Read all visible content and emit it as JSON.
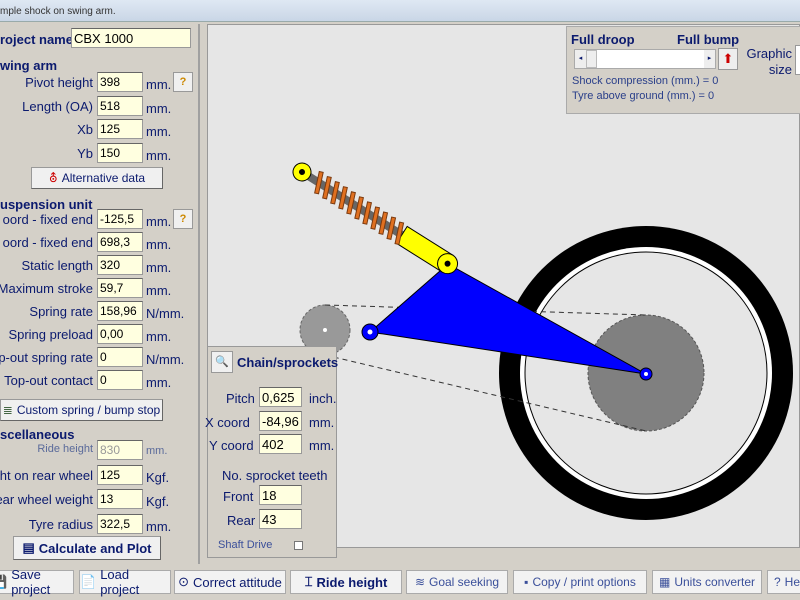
{
  "window": {
    "title": "mple shock on swing arm."
  },
  "project": {
    "label": "roject name",
    "value": "CBX 1000"
  },
  "swing_arm": {
    "header": "wing arm",
    "fields": [
      {
        "label": "Pivot height",
        "value": "398",
        "unit": "mm."
      },
      {
        "label": "Length (OA)",
        "value": "518",
        "unit": "mm."
      },
      {
        "label": "Xb",
        "value": "125",
        "unit": "mm."
      },
      {
        "label": "Yb",
        "value": "150",
        "unit": "mm."
      }
    ],
    "alt_button": "Alternative data",
    "help": "?"
  },
  "suspension": {
    "header": "uspension unit",
    "fields": [
      {
        "label": "oord - fixed end",
        "value": "-125,5",
        "unit": "mm."
      },
      {
        "label": "oord - fixed end",
        "value": "698,3",
        "unit": "mm."
      },
      {
        "label": "Static length",
        "value": "320",
        "unit": "mm."
      },
      {
        "label": "Maximum stroke",
        "value": "59,7",
        "unit": "mm."
      },
      {
        "label": "Spring rate",
        "value": "158,96",
        "unit": "N/mm."
      },
      {
        "label": "Spring preload",
        "value": "0,00",
        "unit": "mm."
      },
      {
        "label": "p-out spring rate",
        "value": "0",
        "unit": "N/mm."
      },
      {
        "label": "Top-out contact",
        "value": "0",
        "unit": "mm."
      }
    ],
    "custom_button": "Custom spring / bump stop",
    "help": "?"
  },
  "misc": {
    "header": "scellaneous",
    "fields": [
      {
        "label": "Ride height",
        "value": "830",
        "unit": "mm.",
        "disabled": true
      },
      {
        "label": "ght on rear wheel",
        "value": "125",
        "unit": "Kgf."
      },
      {
        "label": "ear wheel weight",
        "value": "13",
        "unit": "Kgf."
      },
      {
        "label": "Tyre radius",
        "value": "322,5",
        "unit": "mm."
      }
    ],
    "calc_button": "Calculate and Plot"
  },
  "control": {
    "full_droop": "Full droop",
    "full_bump": "Full bump",
    "graphic_size": "Graphic size",
    "slider_value": 0,
    "shock_compression": "Shock compression (mm.) = 0",
    "tyre_above": "Tyre  above ground (mm.) =   0"
  },
  "chain": {
    "title": "Chain/sprockets",
    "pitch": {
      "label": "Pitch",
      "value": "0,625",
      "unit": "inch."
    },
    "x": {
      "label": "X coord",
      "value": "-84,964",
      "unit": "mm."
    },
    "y": {
      "label": "Y coord",
      "value": "402",
      "unit": "mm."
    },
    "teeth_header": "No. sprocket teeth",
    "front": {
      "label": "Front",
      "value": "18"
    },
    "rear": {
      "label": "Rear",
      "value": "43"
    },
    "shaft_drive": "Shaft Drive",
    "shaft_checked": false
  },
  "toolbar": [
    "Save project",
    "Load project",
    "Correct attitude",
    "Ride height",
    "Goal seeking",
    "Copy / print options",
    "Units converter",
    "He"
  ],
  "colors": {
    "swingarm": "#0000ff",
    "shock_body": "#ffff00",
    "spring": "#e07020",
    "tyre": "#000000",
    "sprocket": "#808080"
  }
}
